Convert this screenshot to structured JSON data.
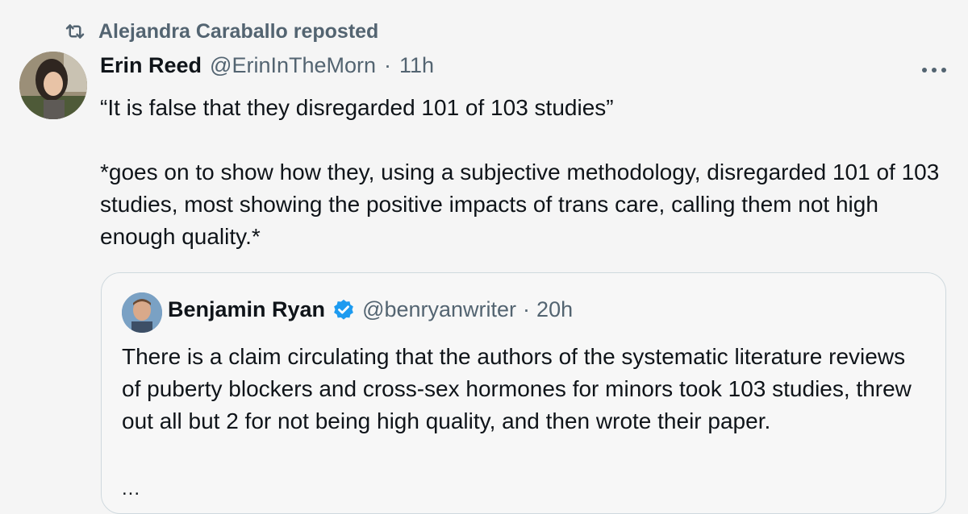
{
  "repost": {
    "icon": "repost-icon",
    "label": "Alejandra Caraballo reposted"
  },
  "tweet": {
    "author_name": "Erin Reed",
    "author_handle": "@ErinInTheMorn",
    "separator": "·",
    "time": "11h",
    "paragraphs": [
      "“It is false that they disregarded 101 of 103 studies”",
      "*goes on to show how they, using a subjective methodology, disregarded 101 of 103 studies, most showing the positive impacts of trans care, calling them not high enough quality.*"
    ],
    "more_icon": "more-horizontal-icon"
  },
  "quote": {
    "author_name": "Benjamin Ryan",
    "verified_icon": "verified-badge-icon",
    "author_handle": "@benryanwriter",
    "separator": "·",
    "time": "20h",
    "text": "There is a claim circulating that the authors of the systematic literature reviews of puberty blockers and cross-sex hormones for minors took 103 studies, threw out all but 2 for not being high quality, and then wrote their paper.",
    "ellipsis": "..."
  },
  "colors": {
    "background": "#f5f5f5",
    "text_primary": "#0f1419",
    "text_secondary": "#536471",
    "verified": "#1d9bf0",
    "card_border": "#cfd9de"
  }
}
